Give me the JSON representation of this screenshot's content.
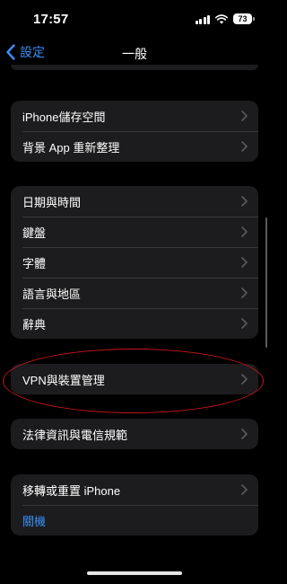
{
  "status_bar": {
    "time": "17:57",
    "battery": "73"
  },
  "nav": {
    "back_label": "設定",
    "title": "一般"
  },
  "groups": [
    {
      "items": [
        {
          "label": "iPhone儲存空間"
        },
        {
          "label": "背景 App 重新整理"
        }
      ]
    },
    {
      "items": [
        {
          "label": "日期與時間"
        },
        {
          "label": "鍵盤"
        },
        {
          "label": "字體"
        },
        {
          "label": "語言與地區"
        },
        {
          "label": "辭典"
        }
      ]
    },
    {
      "items": [
        {
          "label": "VPN與裝置管理"
        }
      ]
    },
    {
      "items": [
        {
          "label": "法律資訊與電信規範"
        }
      ]
    },
    {
      "items": [
        {
          "label": "移轉或重置 iPhone"
        },
        {
          "label": "關機"
        }
      ]
    }
  ],
  "colors": {
    "background": "#000000",
    "cell": "#1c1c1e",
    "accent": "#3a8ef6",
    "annotation": "#c8161c"
  }
}
